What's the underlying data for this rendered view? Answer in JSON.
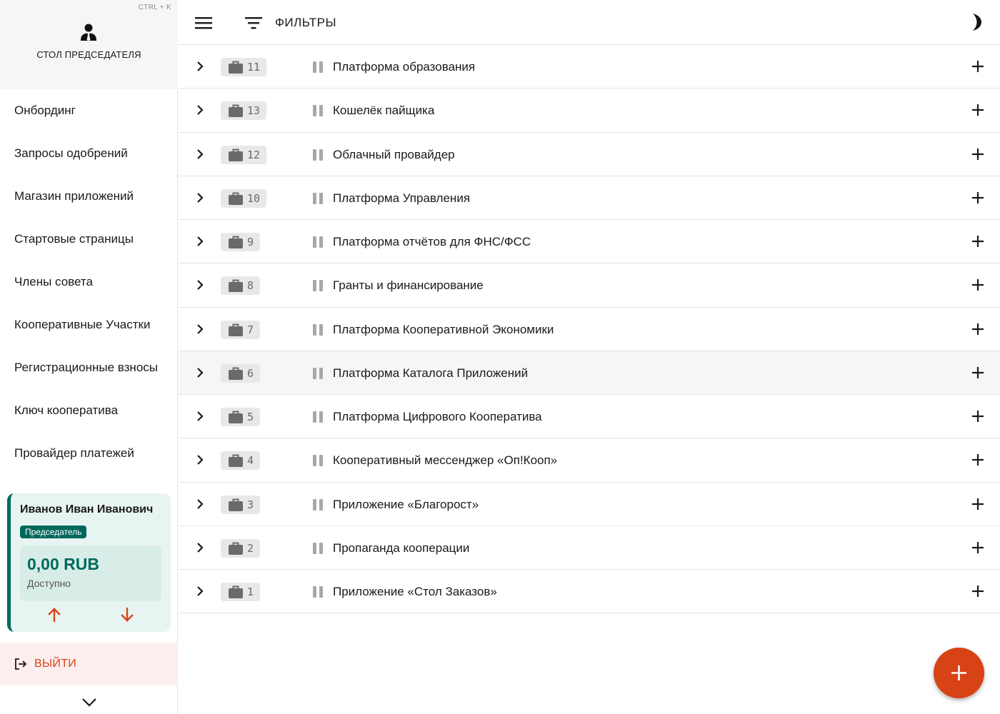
{
  "sidebar": {
    "shortcut": "CTRL + K",
    "desk_title": "СТОЛ ПРЕДСЕДАТЕЛЯ",
    "menu": [
      {
        "label": "Онбординг"
      },
      {
        "label": "Запросы одобрений"
      },
      {
        "label": "Магазин приложений"
      },
      {
        "label": "Стартовые страницы"
      },
      {
        "label": "Члены совета"
      },
      {
        "label": "Кооперативные Участки"
      },
      {
        "label": "Регистрационные взносы"
      },
      {
        "label": "Ключ кооператива"
      },
      {
        "label": "Провайдер платежей"
      }
    ],
    "user": {
      "name": "Иванов Иван Иванович",
      "role": "Председатель",
      "balance": "0,00 RUB",
      "balance_label": "Доступно"
    },
    "logout_label": "ВЫЙТИ"
  },
  "topbar": {
    "filters_label": "ФИЛЬТРЫ"
  },
  "list": {
    "rows": [
      {
        "num": "11",
        "title": "Платформа образования"
      },
      {
        "num": "13",
        "title": "Кошелёк пайщика"
      },
      {
        "num": "12",
        "title": "Облачный провайдер"
      },
      {
        "num": "10",
        "title": "Платформа Управления"
      },
      {
        "num": "9",
        "title": "Платформа отчётов для ФНС/ФСС"
      },
      {
        "num": "8",
        "title": "Гранты и финансирование"
      },
      {
        "num": "7",
        "title": "Платформа Кооперативной Экономики"
      },
      {
        "num": "6",
        "title": "Платформа Каталога Приложений"
      },
      {
        "num": "5",
        "title": "Платформа Цифрового Кооператива"
      },
      {
        "num": "4",
        "title": "Кооперативный мессенджер «Оп!Кооп»"
      },
      {
        "num": "3",
        "title": "Приложение «Благорост»"
      },
      {
        "num": "2",
        "title": "Пропаганда кооперации"
      },
      {
        "num": "1",
        "title": "Приложение «Стол Заказов»"
      }
    ],
    "highlighted_index": 7
  },
  "colors": {
    "accent": "#d84315",
    "primary": "#00695c",
    "card_bg": "#e8f4f1",
    "logout_bg": "#fdeeee"
  },
  "icons": {
    "header": "person-tie-icon",
    "menu": "hamburger-icon",
    "filter": "filter-icon",
    "theme": "moon-icon",
    "row_expand": "chevron-right-icon",
    "row_badge": "briefcase-icon",
    "row_status": "pause-icon",
    "row_add": "plus-icon",
    "fab": "plus-icon",
    "logout": "logout-icon"
  }
}
